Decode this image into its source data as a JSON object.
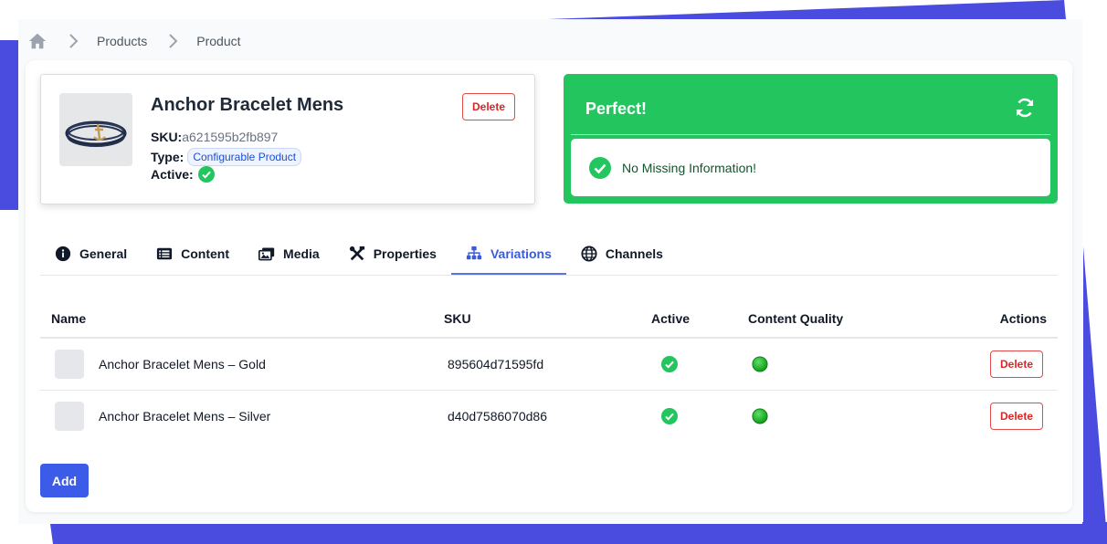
{
  "breadcrumb": {
    "items": [
      "Products",
      "Product"
    ]
  },
  "product": {
    "title": "Anchor Bracelet Mens",
    "sku_label": "SKU:",
    "sku_value": "a621595b2fb897",
    "type_label": "Type:",
    "type_value": "Configurable Product",
    "active_label": "Active:",
    "delete_label": "Delete"
  },
  "status": {
    "title": "Perfect!",
    "message": "No Missing Information!",
    "color": "#22c55e"
  },
  "tabs": [
    {
      "label": "General",
      "icon": "info-icon"
    },
    {
      "label": "Content",
      "icon": "list-icon"
    },
    {
      "label": "Media",
      "icon": "images-icon"
    },
    {
      "label": "Properties",
      "icon": "tools-icon"
    },
    {
      "label": "Variations",
      "icon": "sitemap-icon",
      "active": true
    },
    {
      "label": "Channels",
      "icon": "globe-icon"
    }
  ],
  "table": {
    "headers": {
      "name": "Name",
      "sku": "SKU",
      "active": "Active",
      "quality": "Content Quality",
      "actions": "Actions"
    },
    "rows": [
      {
        "name": "Anchor Bracelet Mens – Gold",
        "sku": "895604d71595fd",
        "active": true,
        "quality": "good",
        "action": "Delete"
      },
      {
        "name": "Anchor Bracelet Mens – Silver",
        "sku": "d40d7586070d86",
        "active": true,
        "quality": "good",
        "action": "Delete"
      }
    ]
  },
  "add_label": "Add",
  "colors": {
    "accent": "#3b5be8",
    "danger": "#dc2626",
    "success": "#22c55e",
    "background_shape": "#4a4ce0"
  }
}
